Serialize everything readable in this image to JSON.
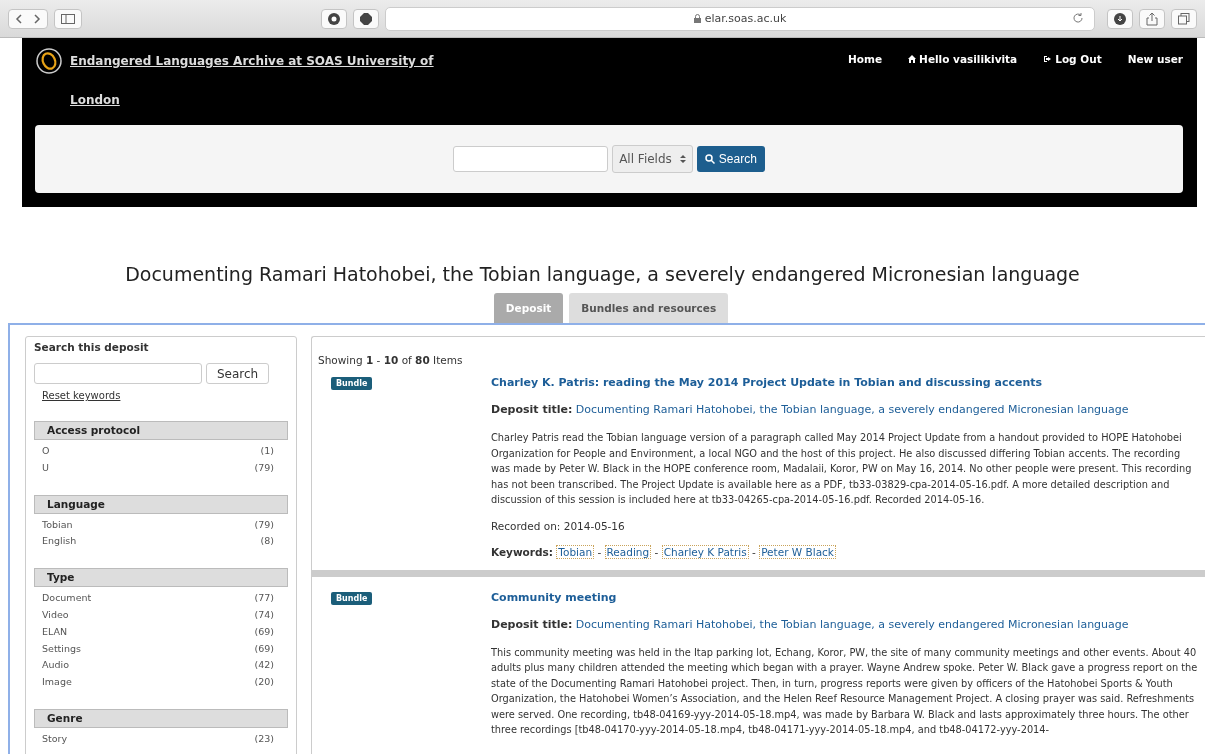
{
  "browser": {
    "url": "elar.soas.ac.uk"
  },
  "header": {
    "site_title": "Endangered Languages Archive at SOAS University of London",
    "nav": [
      {
        "label": "Home",
        "kind": "plain"
      },
      {
        "label": "Hello vasilikivita",
        "kind": "account"
      },
      {
        "label": "Log Out",
        "kind": "logout"
      },
      {
        "label": "New user",
        "kind": "plain"
      }
    ],
    "search": {
      "field": "All Fields",
      "button": "Search"
    }
  },
  "page_title": "Documenting Ramari Hatohobei, the Tobian language, a severely endangered Micronesian language",
  "tabs": [
    {
      "label": "Deposit",
      "selected": true
    },
    {
      "label": "Bundles and resources",
      "selected": false
    }
  ],
  "sidebar": {
    "title": "Search this deposit",
    "search_button": "Search",
    "reset": "Reset keywords",
    "facets": [
      {
        "heading": "Access protocol",
        "items": [
          {
            "label": "O",
            "count": "(1)"
          },
          {
            "label": "U",
            "count": "(79)"
          }
        ]
      },
      {
        "heading": "Language",
        "items": [
          {
            "label": "Tobian",
            "count": "(79)"
          },
          {
            "label": "English",
            "count": "(8)"
          }
        ]
      },
      {
        "heading": "Type",
        "items": [
          {
            "label": "Document",
            "count": "(77)"
          },
          {
            "label": "Video",
            "count": "(74)"
          },
          {
            "label": "ELAN",
            "count": "(69)"
          },
          {
            "label": "Settings",
            "count": "(69)"
          },
          {
            "label": "Audio",
            "count": "(42)"
          },
          {
            "label": "Image",
            "count": "(20)"
          }
        ]
      },
      {
        "heading": "Genre",
        "items": [
          {
            "label": "Story",
            "count": "(23)"
          }
        ]
      }
    ]
  },
  "results": {
    "summary": "Showing **1** - **10** of **80** Items",
    "items": [
      {
        "badge": "Bundle",
        "title": "Charley K. Patris: reading the May 2014 Project Update in Tobian and discussing accents",
        "deposit_label": "Deposit title:",
        "deposit_title": "Documenting Ramari Hatohobei, the Tobian language, a severely endangered Micronesian language",
        "description": "Charley Patris read the Tobian language version of a paragraph called May 2014 Project Update from a handout provided to HOPE Hatohobei Organization for People and Environment, a local NGO and the host of this project. He also discussed differing Tobian accents. The recording was made by Peter W. Black in the HOPE conference room, Madalaii, Koror, PW on May 16, 2014. No other people were present. This recording has not been transcribed. The Project Update is available here as a PDF, tb33-03829-cpa-2014-05-16.pdf. A more detailed description and discussion of this session is included here at tb33-04265-cpa-2014-05-16.pdf. Recorded 2014-05-16.",
        "recorded": "Recorded on: 2014-05-16",
        "keywords_label": "Keywords:",
        "keyword_separator": "-",
        "keywords": [
          "Tobian",
          "Reading",
          "Charley K Patris",
          "Peter W Black"
        ]
      },
      {
        "badge": "Bundle",
        "title": "Community meeting",
        "deposit_label": "Deposit title:",
        "deposit_title": "Documenting Ramari Hatohobei, the Tobian language, a severely endangered Micronesian language",
        "description": "This community meeting was held in the Itap parking lot, Echang, Koror, PW, the site of many community meetings and other events. About 40 adults plus many children attended the meeting which began with a prayer. Wayne Andrew spoke. Peter W. Black gave a progress report on the state of the Documenting Ramari Hatohobei project. Then, in turn, progress reports were given by officers of the Hatohobei Sports & Youth Organization, the Hatohobei Women’s Association, and the Helen Reef Resource Management Project. A closing prayer was said. Refreshments were served. One recording, tb48-04169-yyy-2014-05-18.mp4, was made by Barbara W. Black and lasts approximately three hours. The other three recordings [tb48-04170-yyy-2014-05-18.mp4, tb48-04171-yyy-2014-05-18.mp4, and tb48-04172-yyy-2014-"
      }
    ]
  }
}
